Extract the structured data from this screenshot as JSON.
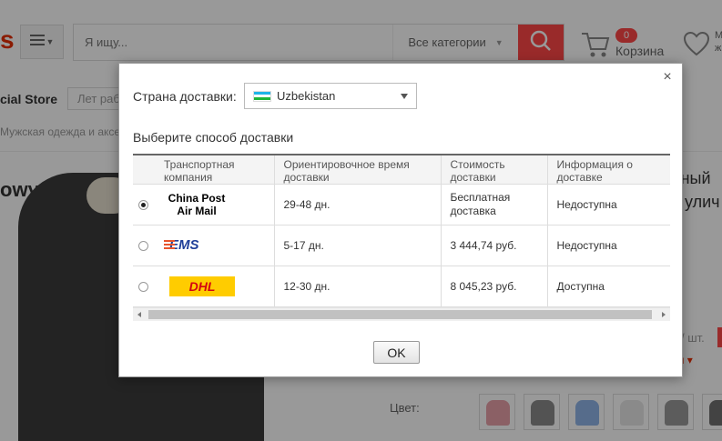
{
  "header": {
    "logo_fragment": "s",
    "search_placeholder": "Я ищу...",
    "search_category": "Все категории",
    "cart_count": "0",
    "cart_label": "Корзина",
    "wishlist_label_line1": "М",
    "wishlist_label_line2": "ж"
  },
  "store": {
    "name_fragment": "cial Store",
    "years_fragment": "Лет раб"
  },
  "breadcrumb": "Мужская одежда и аксе",
  "product": {
    "title_fragment": "owy",
    "right_text_1": "вный",
    "right_text_2": "с улич",
    "right_text_3": ")",
    "price_unit_fragment": "/ шт.",
    "more_fragment": "ии ▾",
    "color_label": "Цвет:",
    "swatch_colors": [
      "#e8a0a8",
      "#8a8a8a",
      "#8fb4e8",
      "#e6e6e6",
      "#9a9a9a",
      "#707070"
    ]
  },
  "dialog": {
    "close_glyph": "×",
    "country_label": "Страна доставки:",
    "country_value": "Uzbekistan",
    "method_heading": "Выберите способ доставки",
    "columns": [
      "Транспортная компания",
      "Ориентировочное время доставки",
      "Стоимость доставки",
      "Информация о доставке"
    ],
    "rows": [
      {
        "carrier": "China Post Air Mail",
        "carrier_line1": "China Post",
        "carrier_line2": "Air Mail",
        "time": "29-48 дн.",
        "cost": "Бесплатная доставка",
        "tracking": "Недоступна",
        "selected": true
      },
      {
        "carrier": "EMS",
        "carrier_logo_text": "EMS",
        "time": "5-17 дн.",
        "cost": "3 444,74 руб.",
        "tracking": "Недоступна",
        "selected": false
      },
      {
        "carrier": "DHL",
        "carrier_logo_text": "DHL",
        "time": "12-30 дн.",
        "cost": "8 045,23 руб.",
        "tracking": "Доступна",
        "selected": false
      }
    ],
    "ok_label": "OK"
  },
  "colors": {
    "accent": "#ff4747",
    "cost_red": "#e8542c"
  }
}
